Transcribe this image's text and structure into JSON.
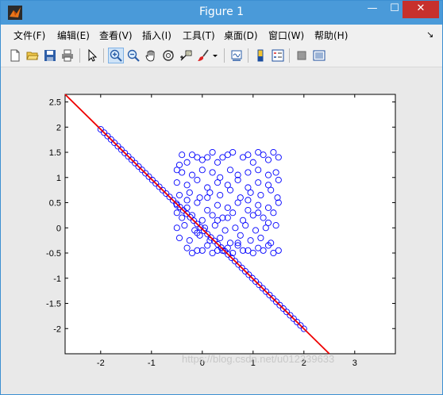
{
  "window": {
    "title": "Figure 1",
    "minimize": "—",
    "maximize": "☐",
    "close": "✕"
  },
  "menus": [
    {
      "label": "文件(F)"
    },
    {
      "label": "编辑(E)"
    },
    {
      "label": "查看(V)"
    },
    {
      "label": "插入(I)"
    },
    {
      "label": "工具(T)"
    },
    {
      "label": "桌面(D)"
    },
    {
      "label": "窗口(W)"
    },
    {
      "label": "帮助(H)"
    }
  ],
  "menu_overflow": "↘",
  "toolbar": [
    {
      "icon": "new-figure-icon"
    },
    {
      "icon": "open-file-icon"
    },
    {
      "icon": "save-icon"
    },
    {
      "icon": "print-icon"
    },
    {
      "icon": "edit-plot-arrow-icon"
    },
    {
      "icon": "zoom-in-icon",
      "active": true
    },
    {
      "icon": "zoom-out-icon"
    },
    {
      "icon": "pan-hand-icon"
    },
    {
      "icon": "rotate-3d-icon"
    },
    {
      "icon": "data-cursor-icon"
    },
    {
      "icon": "brush-icon"
    },
    {
      "icon": "link-plot-icon"
    },
    {
      "icon": "colorbar-icon"
    },
    {
      "icon": "legend-icon"
    },
    {
      "icon": "hide-plot-tools-icon"
    },
    {
      "icon": "show-plot-tools-icon"
    }
  ],
  "watermark": "https://blog.csdn.net/u012339633",
  "colors": {
    "title_bar": "#4a9ad9",
    "close_button": "#c7302c",
    "marker": "#0000ff",
    "line": "#ee0000"
  },
  "chart_data": {
    "type": "scatter",
    "title": "",
    "xlabel": "",
    "ylabel": "",
    "xlim": [
      -2.7,
      3.8
    ],
    "ylim": [
      -2.5,
      2.65
    ],
    "xticks": [
      -2,
      -1,
      0,
      1,
      2,
      3
    ],
    "yticks": [
      -2,
      -1.5,
      -1,
      -0.5,
      0,
      0.5,
      1,
      1.5,
      2,
      2.5
    ],
    "xtick_labels": [
      "-2",
      "-1",
      "0",
      "1",
      "2",
      "3"
    ],
    "ytick_labels": [
      "-2",
      "-1.5",
      "-1",
      "-0.5",
      "0",
      "0.5",
      "1",
      "1.5",
      "2",
      "2.5"
    ],
    "grid": false,
    "legend": "none",
    "series": [
      {
        "marker": "circle",
        "color": "#0000ff",
        "description": "scattered original points",
        "x": [
          -0.5,
          -0.45,
          -0.4,
          -0.3,
          -0.2,
          -0.1,
          0.0,
          0.1,
          0.2,
          0.3,
          0.4,
          0.5,
          0.6,
          0.8,
          0.9,
          1.0,
          1.1,
          1.2,
          1.3,
          1.4,
          1.5,
          -0.4,
          -0.2,
          0.0,
          0.2,
          0.35,
          0.55,
          0.7,
          0.9,
          1.1,
          1.3,
          1.45,
          -0.5,
          -0.3,
          -0.1,
          0.1,
          0.3,
          0.5,
          0.7,
          0.9,
          1.1,
          1.3,
          1.5,
          -0.45,
          -0.25,
          -0.05,
          0.15,
          0.35,
          0.55,
          0.75,
          0.95,
          1.15,
          1.35,
          1.48,
          -0.5,
          -0.3,
          -0.1,
          0.1,
          0.3,
          0.5,
          0.7,
          0.9,
          1.1,
          1.3,
          1.5,
          -0.4,
          -0.2,
          0.0,
          0.2,
          0.4,
          0.6,
          0.8,
          1.0,
          1.2,
          1.4,
          -0.5,
          -0.35,
          -0.15,
          0.05,
          0.25,
          0.45,
          0.65,
          0.85,
          1.05,
          1.25,
          1.45,
          -0.45,
          -0.25,
          -0.05,
          0.15,
          0.35,
          0.55,
          0.75,
          0.95,
          1.15,
          1.35,
          -0.3,
          -0.1,
          0.1,
          0.3,
          0.5,
          0.7,
          0.9,
          1.1,
          1.3,
          1.5,
          -0.2,
          0.0,
          0.2,
          0.4,
          0.6,
          0.8,
          1.0,
          1.2,
          1.4,
          -0.5,
          -0.3,
          -0.1,
          0.1,
          0.3,
          0.5,
          0.7,
          0.9,
          1.1,
          1.3
        ],
        "y": [
          1.15,
          1.25,
          1.45,
          1.3,
          1.45,
          1.4,
          1.35,
          1.4,
          1.5,
          1.3,
          1.4,
          1.45,
          1.5,
          1.4,
          1.45,
          1.3,
          1.5,
          1.45,
          1.35,
          1.5,
          1.4,
          1.1,
          1.05,
          1.15,
          1.1,
          1.0,
          1.15,
          1.05,
          1.1,
          1.15,
          1.05,
          1.1,
          0.9,
          0.85,
          0.95,
          0.8,
          0.9,
          0.85,
          0.95,
          0.8,
          0.9,
          0.85,
          0.95,
          0.65,
          0.7,
          0.6,
          0.7,
          0.65,
          0.75,
          0.6,
          0.7,
          0.65,
          0.75,
          0.6,
          0.45,
          0.4,
          0.5,
          0.35,
          0.45,
          0.4,
          0.5,
          0.35,
          0.45,
          0.4,
          0.5,
          0.2,
          0.25,
          0.15,
          0.25,
          0.2,
          0.3,
          0.15,
          0.25,
          0.2,
          0.3,
          0.0,
          0.05,
          -0.05,
          0.0,
          0.05,
          -0.05,
          0.0,
          0.05,
          -0.05,
          0.0,
          0.05,
          -0.2,
          -0.25,
          -0.15,
          -0.25,
          -0.2,
          -0.3,
          -0.15,
          -0.25,
          -0.2,
          -0.3,
          -0.4,
          -0.45,
          -0.35,
          -0.45,
          -0.4,
          -0.35,
          -0.45,
          -0.4,
          -0.35,
          -0.45,
          -0.5,
          -0.45,
          -0.5,
          -0.45,
          -0.5,
          -0.45,
          -0.5,
          -0.45,
          -0.5,
          0.3,
          0.55,
          -0.1,
          0.6,
          0.15,
          0.2,
          -0.3,
          0.55,
          0.3,
          0.1
        ]
      },
      {
        "marker": "circle",
        "color": "#0000ff",
        "description": "points projected onto the line",
        "line_x_range": [
          -2.0,
          2.0
        ],
        "count": 60
      },
      {
        "type": "line",
        "color": "#ee0000",
        "x": [
          -2.7,
          2.5
        ],
        "y": [
          2.65,
          -2.5
        ]
      }
    ]
  }
}
